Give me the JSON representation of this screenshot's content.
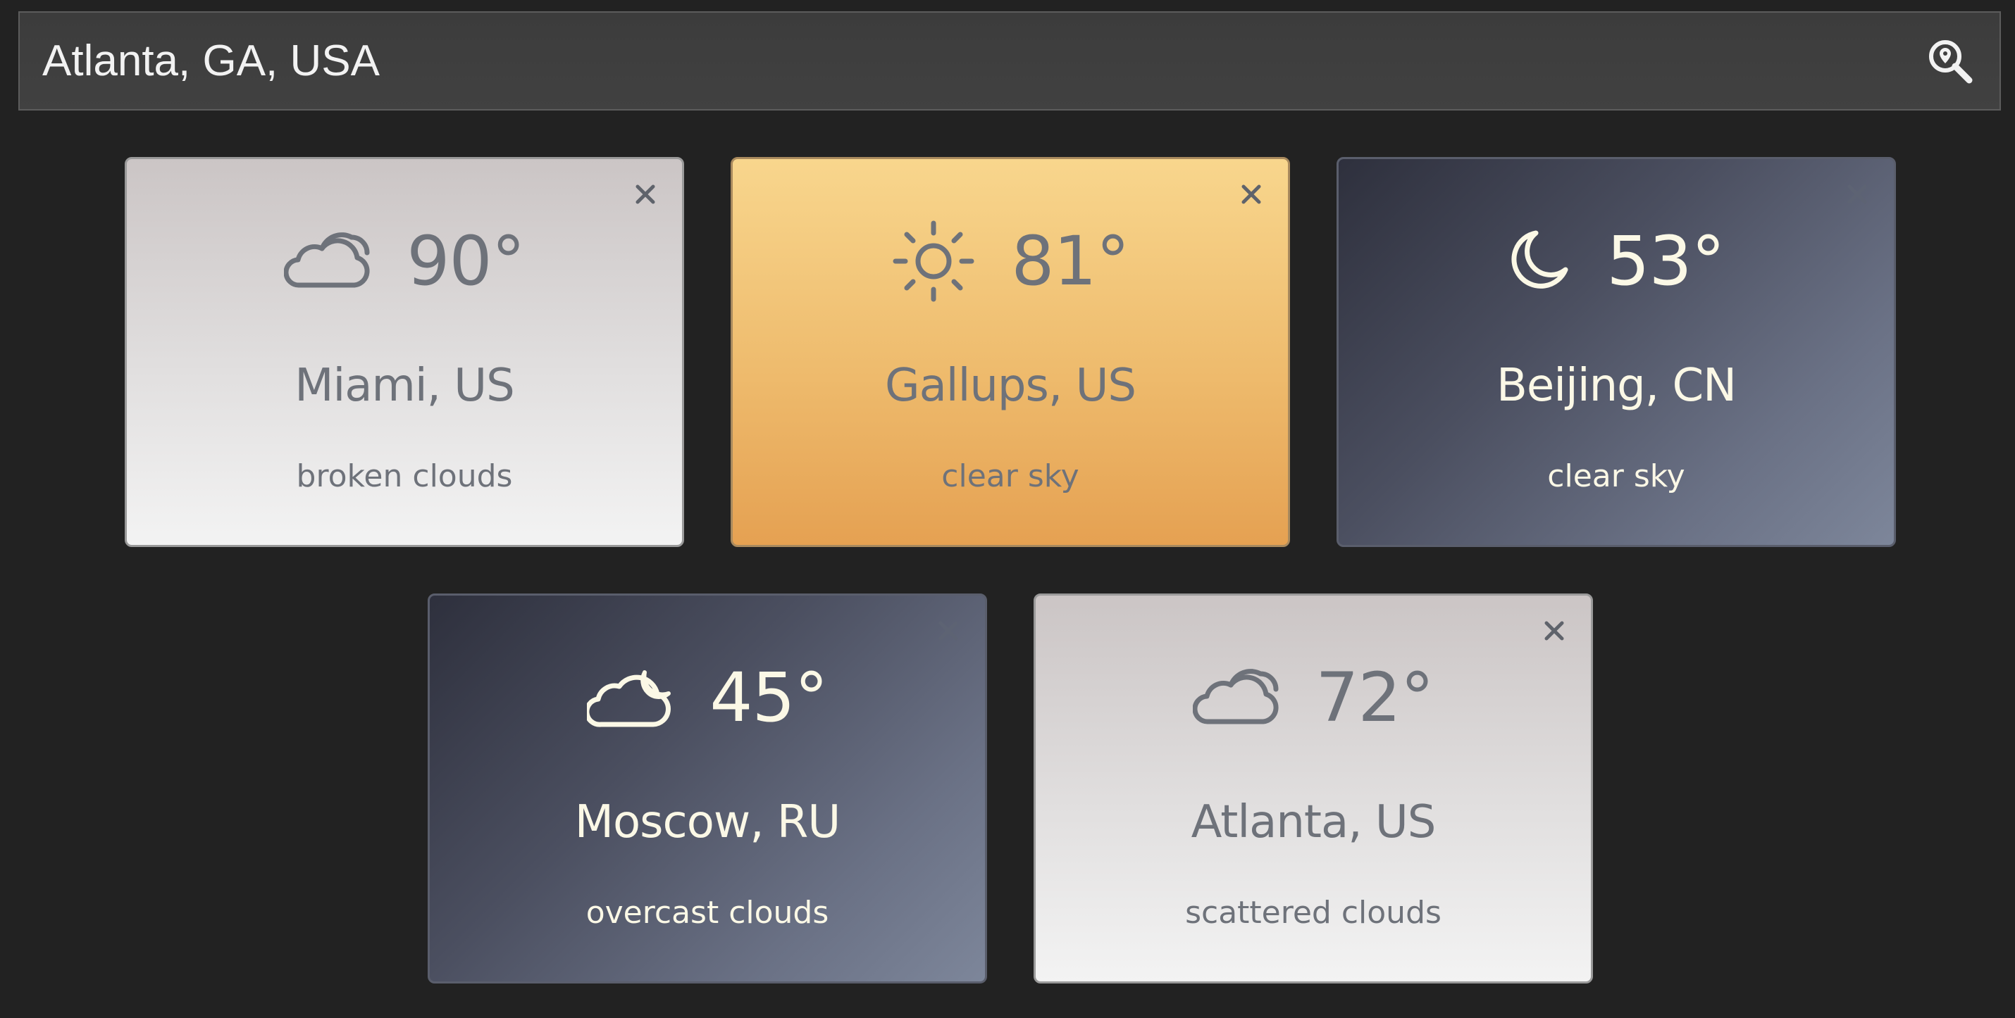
{
  "search": {
    "value": "Atlanta, GA, USA"
  },
  "cards": [
    {
      "theme": "light",
      "icon": "cloud-icon",
      "temp": "90°",
      "city": "Miami, US",
      "description": "broken clouds"
    },
    {
      "theme": "sun",
      "icon": "sun-icon",
      "temp": "81°",
      "city": "Gallups, US",
      "description": "clear sky"
    },
    {
      "theme": "night",
      "icon": "moon-icon",
      "temp": "53°",
      "city": "Beijing, CN",
      "description": "clear sky"
    },
    {
      "theme": "night",
      "icon": "cloud-moon-icon",
      "temp": "45°",
      "city": "Moscow, RU",
      "description": "overcast clouds"
    },
    {
      "theme": "light",
      "icon": "cloud-icon",
      "temp": "72°",
      "city": "Atlanta, US",
      "description": "scattered clouds"
    }
  ],
  "colors": {
    "background": "#222222",
    "light_text": "#6e727a",
    "night_text": "#fbf8e6",
    "sun_top": "#f8d68d",
    "sun_bottom": "#e5a152"
  }
}
